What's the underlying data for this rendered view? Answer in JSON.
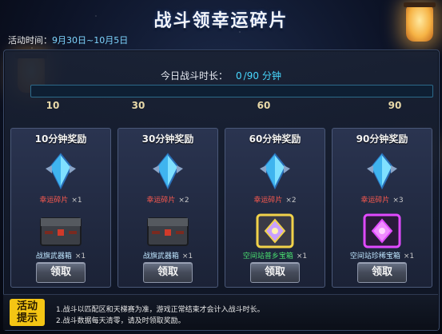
{
  "title": "战斗领幸运碎片",
  "event_time": {
    "label": "活动时间：",
    "dates": "9月30日~10月5日"
  },
  "progress": {
    "label": "今日战斗时长：",
    "current": "0",
    "separator": "/",
    "goal": "90",
    "unit": "分钟",
    "fraction": 0.0,
    "ticks": [
      "10",
      "30",
      "60",
      "90"
    ]
  },
  "rewards": [
    {
      "header": "10分钟奖励",
      "item1": "幸运碎片",
      "count1": "×1",
      "item2": "战旗武器箱",
      "count2": "×1",
      "box_color": "gray",
      "claim": "领取"
    },
    {
      "header": "30分钟奖励",
      "item1": "幸运碎片",
      "count1": "×2",
      "item2": "战旗武器箱",
      "count2": "×1",
      "box_color": "gray",
      "claim": "领取"
    },
    {
      "header": "60分钟奖励",
      "item1": "幸运碎片",
      "count1": "×2",
      "item2": "空间站普乡宝箱",
      "count2": "×1",
      "box_color": "gold",
      "claim": "领取"
    },
    {
      "header": "90分钟奖励",
      "item1": "幸运碎片",
      "count1": "×3",
      "item2": "空间站珍稀宝箱",
      "count2": "×1",
      "box_color": "purple",
      "claim": "领取"
    }
  ],
  "notice": {
    "badge_line1": "活动",
    "badge_line2": "提示",
    "rules": [
      "1.战斗以匹配区和天梯赛为准，游戏正常结束才会计入战斗时长。",
      "2.战斗数据每天清零，请及时领取奖励。"
    ]
  },
  "colors": {
    "accent_blue": "#48d8ff",
    "item_red": "#ff5a4f",
    "badge_yellow": "#f4c514"
  }
}
